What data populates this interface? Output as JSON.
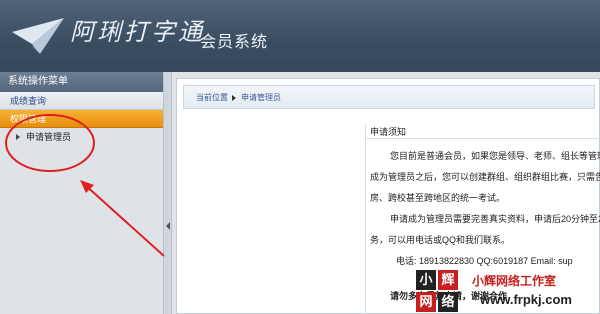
{
  "header": {
    "brand_name": "阿琍打字通",
    "system_title": "会员系统"
  },
  "sidebar": {
    "title": "系统操作菜单",
    "groups": [
      {
        "label": "成绩查询",
        "active": false
      },
      {
        "label": "权限管理",
        "active": true
      }
    ],
    "sub_items": [
      {
        "label": "申请管理员"
      }
    ]
  },
  "breadcrumb": {
    "location_label": "当前位置",
    "current": "申请管理员"
  },
  "notice": {
    "title": "申请须知",
    "lines": [
      "您目前是普通会员，如果您是领导、老师、组长等管理",
      "成为管理员之后，您可以创建群组、组织群组比赛，只需告",
      "房、跨校甚至跨地区的统一考试。",
      "申请成为管理员需要完善真实资料，申请后20分钟至2",
      "务，可以用电话或QQ和我们联系。",
      "电话: 18913822830      QQ:6019187      Email: sup",
      "请勿多次重复申请，谢谢合作"
    ]
  },
  "watermark": {
    "badge": [
      "小",
      "辉",
      "网",
      "络"
    ],
    "studio": "小辉网络工作室",
    "url": "www.frpkj.com"
  },
  "colors": {
    "header_bg": "#3f5266",
    "active_menu": "#f0a020",
    "annotation_red": "#e02020"
  }
}
